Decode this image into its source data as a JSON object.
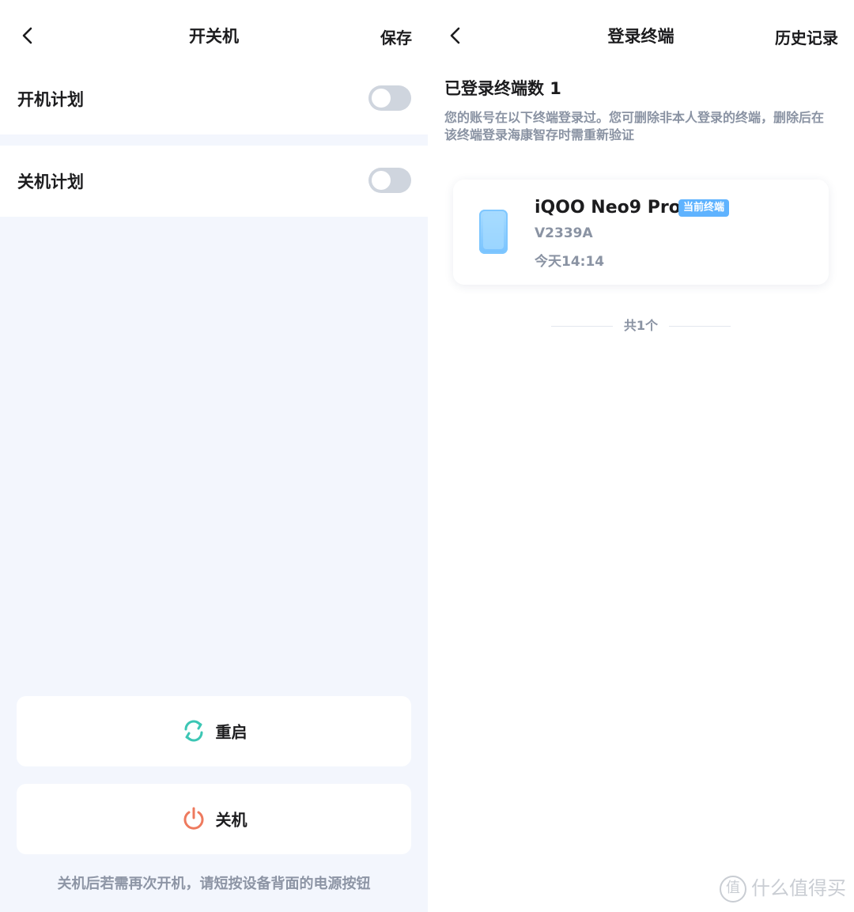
{
  "left": {
    "nav": {
      "title": "开关机",
      "action": "保存"
    },
    "schedules": [
      {
        "label": "开机计划",
        "enabled": false
      },
      {
        "label": "关机计划",
        "enabled": false
      }
    ],
    "buttons": {
      "restart": {
        "label": "重启",
        "icon": "restart-icon",
        "color": "#3cc6b4"
      },
      "shutdown": {
        "label": "关机",
        "icon": "power-icon",
        "color": "#ee7a5e"
      }
    },
    "hint": "关机后若需再次开机，请短按设备背面的电源按钮"
  },
  "right": {
    "nav": {
      "title": "登录终端",
      "action": "历史记录"
    },
    "count_title": "已登录终端数  1",
    "description": "您的账号在以下终端登录过。您可删除非本人登录的终端，删除后在该终端登录海康智存时需重新验证",
    "devices": [
      {
        "name": "iQOO Neo9 Pro",
        "badge": "当前终端",
        "model": "V2339A",
        "time": "今天14:14",
        "icon": "phone-icon"
      }
    ],
    "total": "共1个"
  },
  "watermark": {
    "icon": "值",
    "text": "什么值得买"
  }
}
